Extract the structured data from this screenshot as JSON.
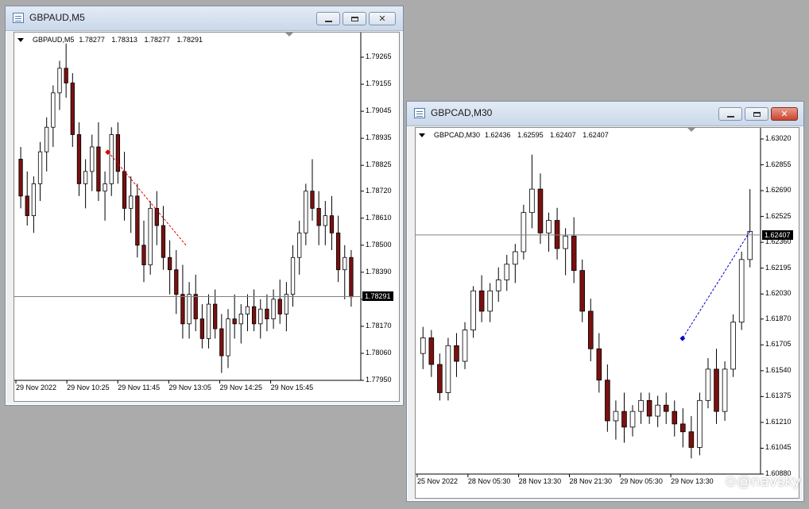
{
  "windows": [
    {
      "title": "GBPAUD,M5",
      "ohlc": {
        "symbol_tf": "GBPAUD,M5",
        "open": "1.78277",
        "high": "1.78313",
        "low": "1.78277",
        "close": "1.78291"
      },
      "price_scale": [
        "1.79265",
        "1.79155",
        "1.79045",
        "1.78935",
        "1.78825",
        "1.78720",
        "1.78610",
        "1.78500",
        "1.78390",
        "1.78280",
        "1.78170",
        "1.78060",
        "1.77950"
      ],
      "current_price": "1.78291",
      "time_scale": [
        "29 Nov 2022",
        "29 Nov 10:25",
        "29 Nov 11:45",
        "29 Nov 13:05",
        "29 Nov 14:25",
        "29 Nov 15:45"
      ]
    },
    {
      "title": "GBPCAD,M30",
      "ohlc": {
        "symbol_tf": "GBPCAD,M30",
        "open": "1.62436",
        "high": "1.62595",
        "low": "1.62407",
        "close": "1.62407"
      },
      "price_scale": [
        "1.63020",
        "1.62855",
        "1.62690",
        "1.62525",
        "1.62360",
        "1.62195",
        "1.62030",
        "1.61870",
        "1.61705",
        "1.61540",
        "1.61375",
        "1.61210",
        "1.61045",
        "1.60880"
      ],
      "current_price": "1.62407",
      "time_scale": [
        "25 Nov 2022",
        "28 Nov 05:30",
        "28 Nov 13:30",
        "28 Nov 21:30",
        "29 Nov 05:30",
        "29 Nov 13:30"
      ]
    }
  ],
  "colors": {
    "bull": "#000000",
    "bear": "#000000",
    "bear_fill": "#7a1010",
    "bull_fill": "#ffffff",
    "grid_line": "#808080",
    "arrow_red": "#e00000",
    "arrow_blue": "#0000cc"
  },
  "chart_data": [
    {
      "type": "candlestick",
      "title": "GBPAUD,M5",
      "ylim": [
        1.7795,
        1.7932
      ],
      "y_ticks": [
        1.79265,
        1.79155,
        1.79045,
        1.78935,
        1.78825,
        1.7872,
        1.7861,
        1.785,
        1.7839,
        1.7828,
        1.7817,
        1.7806,
        1.7795
      ],
      "candles": [
        [
          1.7885,
          1.789,
          1.7865,
          1.787
        ],
        [
          1.787,
          1.788,
          1.7858,
          1.7862
        ],
        [
          1.7862,
          1.7878,
          1.7855,
          1.7875
        ],
        [
          1.7875,
          1.7892,
          1.7868,
          1.7888
        ],
        [
          1.7888,
          1.7902,
          1.788,
          1.7898
        ],
        [
          1.7898,
          1.7915,
          1.789,
          1.7912
        ],
        [
          1.7912,
          1.7925,
          1.7905,
          1.7922
        ],
        [
          1.7922,
          1.7932,
          1.791,
          1.7916
        ],
        [
          1.7916,
          1.792,
          1.789,
          1.7895
        ],
        [
          1.7895,
          1.79,
          1.787,
          1.7875
        ],
        [
          1.7875,
          1.7885,
          1.7865,
          1.788
        ],
        [
          1.788,
          1.7895,
          1.7872,
          1.789
        ],
        [
          1.789,
          1.79,
          1.7868,
          1.7872
        ],
        [
          1.7872,
          1.788,
          1.786,
          1.7875
        ],
        [
          1.7875,
          1.7898,
          1.787,
          1.7895
        ],
        [
          1.7895,
          1.79,
          1.7875,
          1.788
        ],
        [
          1.788,
          1.7888,
          1.786,
          1.7865
        ],
        [
          1.7865,
          1.7878,
          1.7855,
          1.787
        ],
        [
          1.787,
          1.7875,
          1.7845,
          1.785
        ],
        [
          1.785,
          1.786,
          1.7835,
          1.7842
        ],
        [
          1.7842,
          1.7868,
          1.7838,
          1.7865
        ],
        [
          1.7865,
          1.7872,
          1.785,
          1.7858
        ],
        [
          1.7858,
          1.7866,
          1.784,
          1.7845
        ],
        [
          1.7845,
          1.7852,
          1.783,
          1.784
        ],
        [
          1.784,
          1.7848,
          1.7822,
          1.783
        ],
        [
          1.783,
          1.7842,
          1.7812,
          1.7818
        ],
        [
          1.7818,
          1.7835,
          1.7812,
          1.783
        ],
        [
          1.783,
          1.7838,
          1.7815,
          1.782
        ],
        [
          1.782,
          1.7826,
          1.7808,
          1.7812
        ],
        [
          1.7812,
          1.783,
          1.7808,
          1.7826
        ],
        [
          1.7826,
          1.7832,
          1.7812,
          1.7816
        ],
        [
          1.7816,
          1.7822,
          1.7798,
          1.7805
        ],
        [
          1.7805,
          1.7824,
          1.78,
          1.782
        ],
        [
          1.782,
          1.783,
          1.7812,
          1.7818
        ],
        [
          1.7818,
          1.7826,
          1.781,
          1.7822
        ],
        [
          1.7822,
          1.783,
          1.7815,
          1.7825
        ],
        [
          1.7825,
          1.7832,
          1.7815,
          1.7818
        ],
        [
          1.7818,
          1.7828,
          1.7812,
          1.7824
        ],
        [
          1.7824,
          1.783,
          1.7815,
          1.782
        ],
        [
          1.782,
          1.7832,
          1.7816,
          1.7828
        ],
        [
          1.7828,
          1.7836,
          1.7818,
          1.7822
        ],
        [
          1.7822,
          1.7835,
          1.7815,
          1.783
        ],
        [
          1.783,
          1.785,
          1.7825,
          1.7845
        ],
        [
          1.7845,
          1.786,
          1.7838,
          1.7855
        ],
        [
          1.7855,
          1.7875,
          1.785,
          1.7872
        ],
        [
          1.7872,
          1.7885,
          1.786,
          1.7865
        ],
        [
          1.7865,
          1.7872,
          1.785,
          1.7858
        ],
        [
          1.7858,
          1.7868,
          1.785,
          1.7862
        ],
        [
          1.7862,
          1.787,
          1.7848,
          1.7855
        ],
        [
          1.7855,
          1.7862,
          1.7835,
          1.784
        ],
        [
          1.784,
          1.785,
          1.7828,
          1.7845
        ],
        [
          1.7845,
          1.7848,
          1.7825,
          1.7829
        ]
      ]
    },
    {
      "type": "candlestick",
      "title": "GBPCAD,M30",
      "ylim": [
        1.6088,
        1.6302
      ],
      "y_ticks": [
        1.6302,
        1.62855,
        1.6269,
        1.62525,
        1.6236,
        1.62195,
        1.6203,
        1.6187,
        1.61705,
        1.6154,
        1.61375,
        1.6121,
        1.61045,
        1.6088
      ],
      "candles": [
        [
          1.6165,
          1.6182,
          1.6155,
          1.6175
        ],
        [
          1.6175,
          1.618,
          1.615,
          1.6158
        ],
        [
          1.6158,
          1.6165,
          1.6135,
          1.614
        ],
        [
          1.614,
          1.6175,
          1.6135,
          1.617
        ],
        [
          1.617,
          1.6178,
          1.615,
          1.616
        ],
        [
          1.616,
          1.6185,
          1.6155,
          1.618
        ],
        [
          1.618,
          1.6208,
          1.6175,
          1.6205
        ],
        [
          1.6205,
          1.6215,
          1.6185,
          1.6192
        ],
        [
          1.6192,
          1.621,
          1.6185,
          1.6205
        ],
        [
          1.6205,
          1.622,
          1.6198,
          1.6212
        ],
        [
          1.6212,
          1.6228,
          1.6205,
          1.6222
        ],
        [
          1.6222,
          1.6235,
          1.621,
          1.623
        ],
        [
          1.623,
          1.626,
          1.6225,
          1.6255
        ],
        [
          1.6255,
          1.6292,
          1.6245,
          1.627
        ],
        [
          1.627,
          1.628,
          1.6235,
          1.6242
        ],
        [
          1.6242,
          1.6255,
          1.623,
          1.625
        ],
        [
          1.625,
          1.6258,
          1.6225,
          1.6232
        ],
        [
          1.6232,
          1.6245,
          1.6215,
          1.624
        ],
        [
          1.624,
          1.6252,
          1.621,
          1.6218
        ],
        [
          1.6218,
          1.6225,
          1.6185,
          1.6192
        ],
        [
          1.6192,
          1.62,
          1.616,
          1.6168
        ],
        [
          1.6168,
          1.6178,
          1.614,
          1.6148
        ],
        [
          1.6148,
          1.6158,
          1.6115,
          1.6122
        ],
        [
          1.6122,
          1.6135,
          1.611,
          1.6128
        ],
        [
          1.6128,
          1.614,
          1.6108,
          1.6118
        ],
        [
          1.6118,
          1.6132,
          1.6112,
          1.6128
        ],
        [
          1.6128,
          1.614,
          1.612,
          1.6135
        ],
        [
          1.6135,
          1.614,
          1.612,
          1.6125
        ],
        [
          1.6125,
          1.6138,
          1.6118,
          1.6132
        ],
        [
          1.6132,
          1.614,
          1.612,
          1.6128
        ],
        [
          1.6128,
          1.6135,
          1.6112,
          1.612
        ],
        [
          1.612,
          1.613,
          1.6105,
          1.6115
        ],
        [
          1.6115,
          1.6125,
          1.6098,
          1.6105
        ],
        [
          1.6105,
          1.614,
          1.61,
          1.6135
        ],
        [
          1.6135,
          1.6162,
          1.613,
          1.6155
        ],
        [
          1.6155,
          1.6168,
          1.612,
          1.6128
        ],
        [
          1.6128,
          1.616,
          1.6122,
          1.6155
        ],
        [
          1.6155,
          1.619,
          1.615,
          1.6185
        ],
        [
          1.6185,
          1.623,
          1.618,
          1.6225
        ],
        [
          1.6225,
          1.627,
          1.622,
          1.6243
        ]
      ]
    }
  ]
}
